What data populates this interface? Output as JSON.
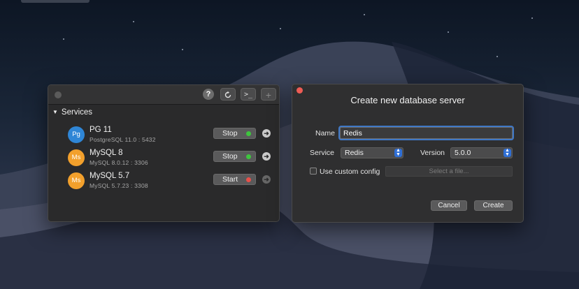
{
  "services_panel": {
    "header": "Services",
    "toolbar": {
      "help_label": "?",
      "refresh_icon": "refresh-icon",
      "terminal_label": ">_",
      "add_label": "+"
    },
    "items": [
      {
        "avatar": "Pg",
        "avatar_color": "#2f86d6",
        "name": "PG 11",
        "detail": "PostgreSQL 11.0 : 5432",
        "action": "Stop",
        "status_color": "#3ec53e"
      },
      {
        "avatar": "Ms",
        "avatar_color": "#f2a02c",
        "name": "MySQL 8",
        "detail": "MySQL 8.0.12 : 3306",
        "action": "Stop",
        "status_color": "#3ec53e"
      },
      {
        "avatar": "Ms",
        "avatar_color": "#f2a02c",
        "name": "MySQL 5.7",
        "detail": "MySQL 5.7.23 : 3308",
        "action": "Start",
        "status_color": "#e8504a"
      }
    ]
  },
  "dialog": {
    "title": "Create new database server",
    "name_label": "Name",
    "name_value": "Redis",
    "service_label": "Service",
    "service_value": "Redis",
    "version_label": "Version",
    "version_value": "5.0.0",
    "custom_config_label": "Use custom config",
    "file_placeholder": "Select a file...",
    "cancel_label": "Cancel",
    "create_label": "Create"
  }
}
